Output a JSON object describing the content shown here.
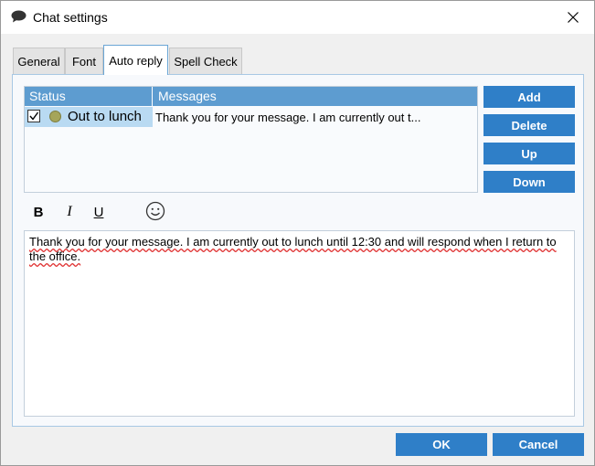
{
  "window": {
    "title": "Chat settings",
    "icons": {
      "title": "chat-bubble-icon",
      "close": "close-icon"
    }
  },
  "tabs": [
    {
      "label": "General",
      "active": false
    },
    {
      "label": "Font",
      "active": false
    },
    {
      "label": "Auto reply",
      "active": true
    },
    {
      "label": "Spell Check",
      "active": false
    }
  ],
  "grid": {
    "columns": [
      "Status",
      "Messages"
    ],
    "rows": [
      {
        "checked": true,
        "status": "Out to lunch",
        "status_color": "#a5a55a",
        "message": "Thank you for your message. I am currently out t..."
      }
    ]
  },
  "side_buttons": {
    "add": "Add",
    "delete": "Delete",
    "up": "Up",
    "down": "Down"
  },
  "formatting": {
    "bold": "B",
    "italic": "I",
    "underline": "U",
    "emoji_icon": "smiley-icon"
  },
  "editor": {
    "text": "Thank you for your message. I am currently out to lunch until 12:30 and will respond when I return to the office."
  },
  "footer": {
    "ok": "OK",
    "cancel": "Cancel"
  },
  "colors": {
    "accent": "#2f7fc8",
    "header": "#5d9cd0",
    "selection": "#b9daf2"
  }
}
